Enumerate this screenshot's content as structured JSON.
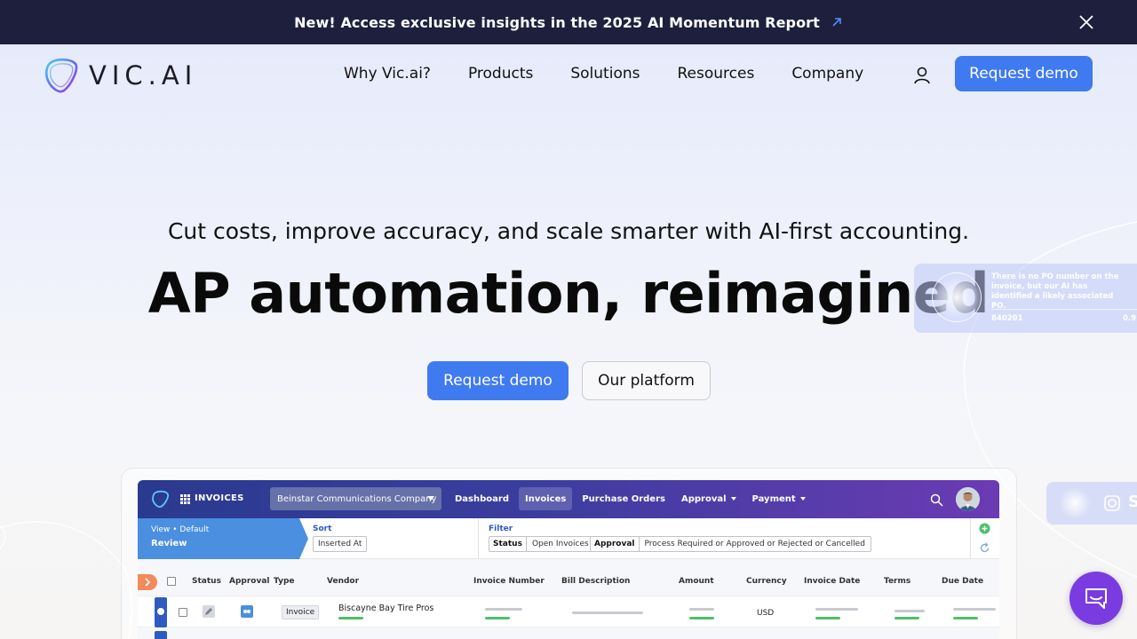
{
  "announcement": {
    "text": "New! Access exclusive insights in the 2025 AI Momentum Report"
  },
  "header": {
    "logo_text": "VIC.AI",
    "nav": [
      "Why Vic.ai?",
      "Products",
      "Solutions",
      "Resources",
      "Company"
    ],
    "cta_label": "Request demo"
  },
  "hero": {
    "subtitle": "Cut costs, improve accuracy, and scale smarter with AI-first accounting.",
    "title": "AP automation, reimagined",
    "primary_cta": "Request demo",
    "secondary_cta": "Our platform"
  },
  "deco_card": {
    "text": "There is no PO number on the invoice, but our AI has identified a likely associated PO.",
    "number": "840201",
    "score": "0.9"
  },
  "deco_card2": {
    "letter": "S"
  },
  "app": {
    "title": "INVOICES",
    "company": "Beinstar Communications Company",
    "nav": [
      {
        "label": "Dashboard"
      },
      {
        "label": "Invoices"
      },
      {
        "label": "Purchase Orders"
      },
      {
        "label": "Approval"
      },
      {
        "label": "Payment"
      }
    ],
    "view_line1": "View • Default",
    "view_line2": "Review",
    "sort_label": "Sort",
    "sort_value": "Inserted At",
    "filter_label": "Filter",
    "filters": [
      {
        "key": "Status",
        "value": "Open Invoices"
      },
      {
        "key": "Approval",
        "value": "Process Required or Approved or Rejected or Cancelled"
      }
    ],
    "columns": [
      "Status",
      "Approval",
      "Type",
      "Vendor",
      "Invoice Number",
      "Bill Description",
      "Amount",
      "Currency",
      "Invoice Date",
      "Terms",
      "Due Date"
    ],
    "row": {
      "type": "Invoice",
      "vendor": "Biscayne Bay Tire Pros",
      "currency": "USD"
    }
  },
  "colors": {
    "brand_blue": "#3f7af0",
    "announce_bg": "#1d1f3d",
    "chat_purple": "#7a3ce0"
  }
}
